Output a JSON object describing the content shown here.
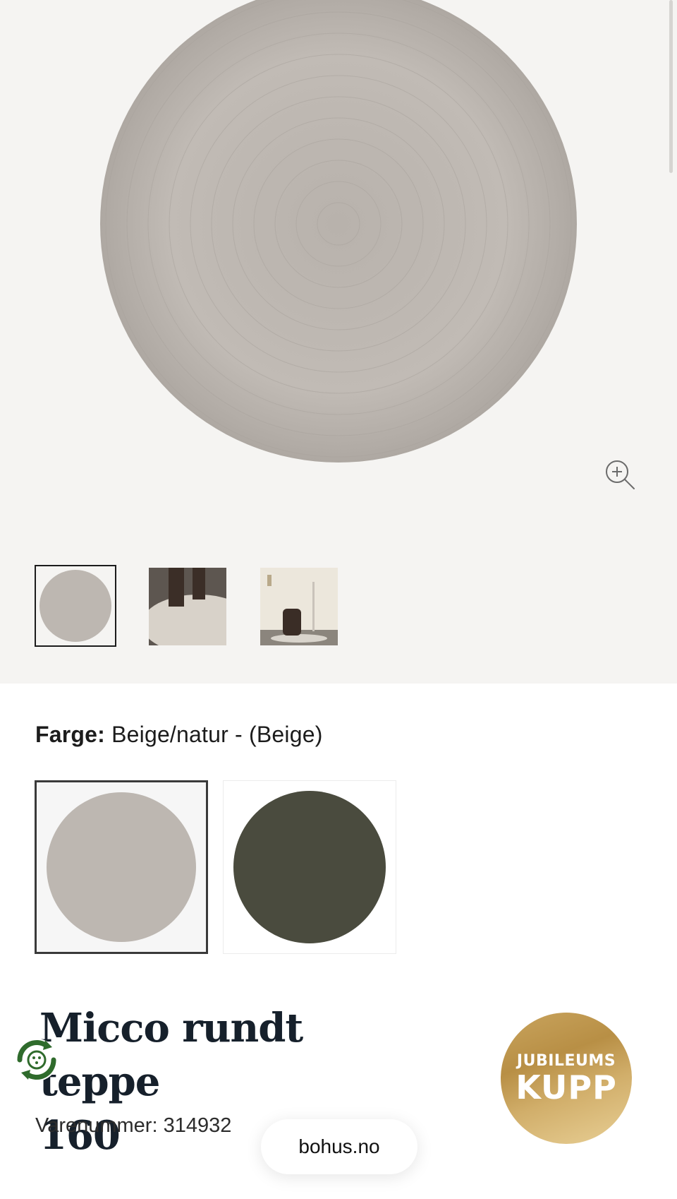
{
  "gallery": {
    "main_image_alt": "",
    "zoom_icon": "zoom-in-icon",
    "thumbnails": [
      {
        "name": "thumb-rug-top-view",
        "selected": true
      },
      {
        "name": "thumb-rug-with-table",
        "selected": false
      },
      {
        "name": "thumb-room-with-chair",
        "selected": false
      }
    ]
  },
  "color": {
    "label": "Farge:",
    "value": "Beige/natur - (Beige)",
    "swatches": [
      {
        "name": "Beige",
        "hex": "#bdb7b1",
        "selected": true
      },
      {
        "name": "Grønn",
        "hex": "#4a4b3e",
        "selected": false
      }
    ]
  },
  "product": {
    "title_line1": "Micco rundt teppe",
    "title_line2": "160",
    "sku": "Varenummer: 314932"
  },
  "badge": {
    "line1": "JUBILEUMS",
    "line2": "KUPP"
  },
  "url_bar": {
    "domain": "bohus.no"
  },
  "icons": {
    "zoom": "zoom-in-icon",
    "recycle": "recycle-icon"
  },
  "colors": {
    "gallery_bg": "#f5f4f2",
    "rug_beige": "#bdb7b1",
    "rug_green": "#4a4b3e",
    "title": "#16202b",
    "badge_gold": "#c9a45e",
    "recycle_green": "#2f6b2c"
  }
}
